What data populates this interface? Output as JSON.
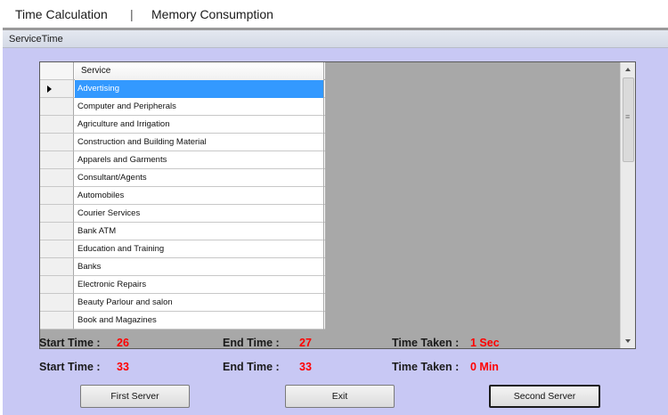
{
  "menubar": {
    "time_calc": "Time Calculation",
    "separator": "|",
    "memory": "Memory Consumption"
  },
  "panel": {
    "title": "ServiceTime"
  },
  "grid": {
    "column_header": "Service",
    "rows": [
      "Advertising",
      "Computer and Peripherals",
      "Agriculture and Irrigation",
      "Construction and Building Material",
      "Apparels and Garments",
      "Consultant/Agents",
      "Automobiles",
      "Courier Services",
      "Bank ATM",
      "Education and Training",
      "Banks",
      "Electronic Repairs",
      "Beauty Parlour and salon",
      "Book and Magazines"
    ],
    "selected_index": 0
  },
  "stats": {
    "row1": {
      "start_label": "Start Time :",
      "start_value": "26",
      "end_label": "End Time :",
      "end_value": "27",
      "taken_label": "Time Taken :",
      "taken_value": "1 Sec"
    },
    "row2": {
      "start_label": "Start Time :",
      "start_value": "33",
      "end_label": "End Time :",
      "end_value": "33",
      "taken_label": "Time Taken :",
      "taken_value": "0 Min"
    }
  },
  "buttons": {
    "first": "First Server",
    "exit": "Exit",
    "second": "Second Server"
  },
  "colors": {
    "panel_bg": "#c8c8f4",
    "selection": "#3399ff",
    "value_red": "#ff0000",
    "grid_bg": "#a8a8a8"
  }
}
